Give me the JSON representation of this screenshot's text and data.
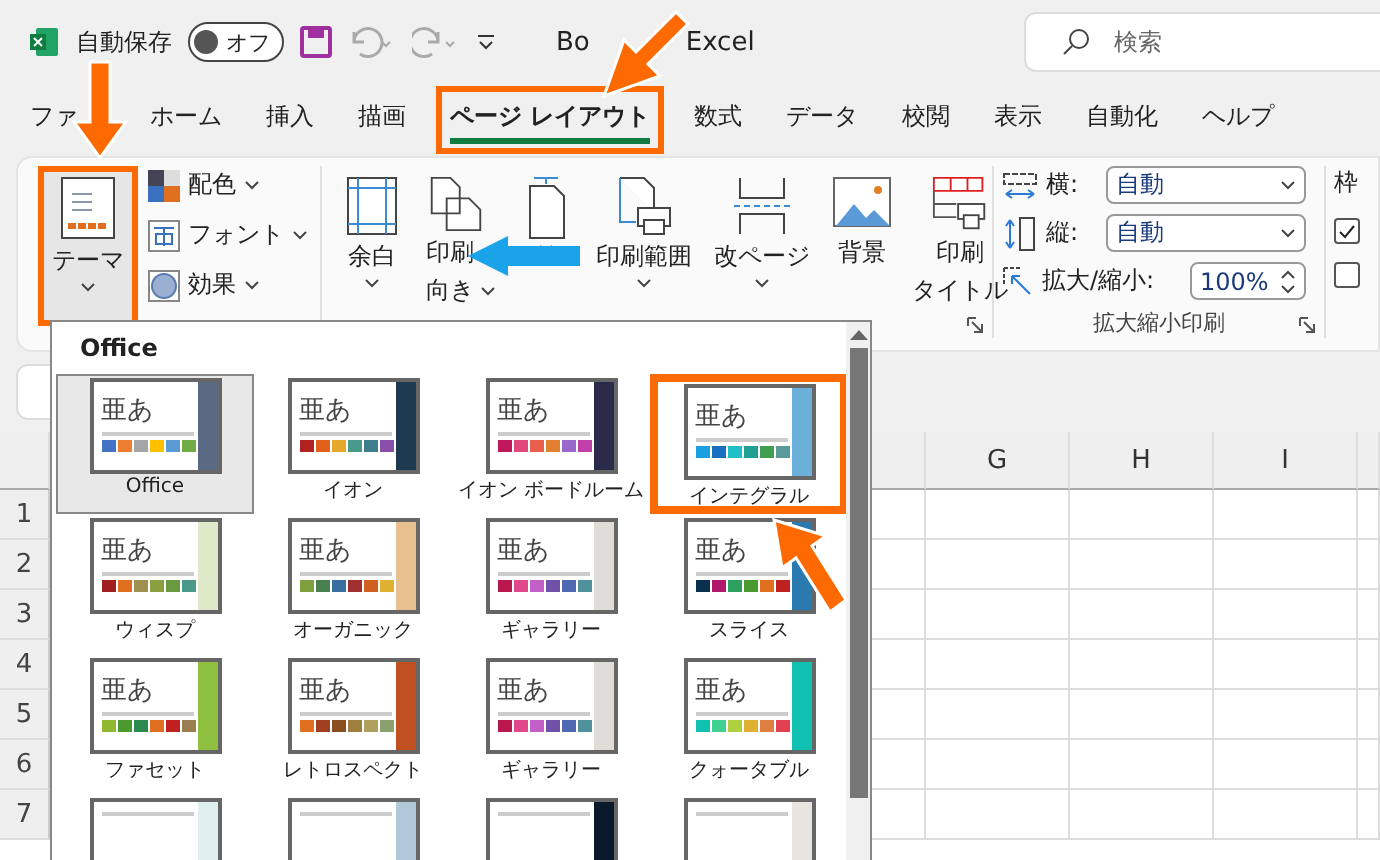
{
  "title_bar": {
    "autosave_label": "自動保存",
    "autosave_toggle": {
      "label": "オフ",
      "on": false
    },
    "doc_title": "Bo",
    "app_name": "Excel",
    "search": {
      "placeholder": "検索"
    }
  },
  "tabs": [
    {
      "label": "ファ",
      "selected": false
    },
    {
      "label": "ホーム",
      "selected": false
    },
    {
      "label": "挿入",
      "selected": false
    },
    {
      "label": "描画",
      "selected": false
    },
    {
      "label": "ページ レイアウト",
      "selected": true,
      "highlighted": true
    },
    {
      "label": "数式",
      "selected": false
    },
    {
      "label": "データ",
      "selected": false
    },
    {
      "label": "校閲",
      "selected": false
    },
    {
      "label": "表示",
      "selected": false
    },
    {
      "label": "自動化",
      "selected": false
    },
    {
      "label": "ヘルプ",
      "selected": false
    }
  ],
  "ribbon": {
    "theme_button": {
      "label": "テーマ",
      "highlighted": true
    },
    "theme_options": [
      {
        "kind": "colors",
        "label": "配色"
      },
      {
        "kind": "fonts",
        "label": "フォント"
      },
      {
        "kind": "effects",
        "label": "効果"
      }
    ],
    "page_setup": [
      {
        "kind": "margins",
        "lines": [
          "余白"
        ]
      },
      {
        "kind": "orientation",
        "lines": [
          "印刷",
          "向き"
        ]
      },
      {
        "kind": "size"
      },
      {
        "kind": "print_area",
        "lines": [
          "印刷範囲"
        ]
      },
      {
        "kind": "breaks",
        "lines": [
          "改ページ"
        ]
      },
      {
        "kind": "background",
        "lines": [
          "背景"
        ]
      },
      {
        "kind": "print_titles",
        "lines": [
          "印刷",
          "タイトル"
        ]
      }
    ],
    "scale": {
      "fields": [
        {
          "kind": "width",
          "label": "横:",
          "value": "自動"
        },
        {
          "kind": "height",
          "label": "縦:",
          "value": "自動"
        },
        {
          "kind": "scale",
          "label": "拡大/縮小:",
          "value": "100%"
        }
      ],
      "group_label": "拡大縮小印刷"
    },
    "sheet_options": {
      "title": "枠",
      "checks": [
        {
          "checked": true
        },
        {
          "checked": false
        }
      ]
    }
  },
  "sheet": {
    "columns": [
      "G",
      "H",
      "I"
    ],
    "rows": [
      "1",
      "2",
      "3",
      "4",
      "5",
      "6",
      "7"
    ]
  },
  "gallery": {
    "heading": "Office",
    "themes": [
      {
        "name": "Office",
        "sample_text": "亜あ",
        "selected": true,
        "highlighted": false,
        "color": "#5a6a85",
        "swatches": [
          {
            "color": "#4472c4"
          },
          {
            "color": "#ed7d31"
          },
          {
            "color": "#a5a5a5"
          },
          {
            "color": "#ffc000"
          },
          {
            "color": "#5b9bd5"
          },
          {
            "color": "#70ad47"
          }
        ]
      },
      {
        "name": "イオン",
        "sample_text": "亜あ",
        "selected": false,
        "highlighted": false,
        "color": "#1e3a50",
        "swatches": [
          {
            "color": "#b22222"
          },
          {
            "color": "#e0601c"
          },
          {
            "color": "#e6a82a"
          },
          {
            "color": "#4a9a8c"
          },
          {
            "color": "#3e7e8c"
          },
          {
            "color": "#8a4fa8"
          }
        ]
      },
      {
        "name": "イオン ボードルーム",
        "sample_text": "亜あ",
        "selected": false,
        "highlighted": false,
        "color": "#2a2a4a",
        "swatches": [
          {
            "color": "#c0185c"
          },
          {
            "color": "#e0487c"
          },
          {
            "color": "#e8604c"
          },
          {
            "color": "#e08030"
          },
          {
            "color": "#9a68c8"
          },
          {
            "color": "#c040a8"
          }
        ]
      },
      {
        "name": "インテグラル",
        "sample_text": "亜あ",
        "selected": false,
        "highlighted": true,
        "color": "#6ab0d8",
        "swatches": [
          {
            "color": "#1aa0e0"
          },
          {
            "color": "#1a70c0"
          },
          {
            "color": "#20c0c8"
          },
          {
            "color": "#20a090"
          },
          {
            "color": "#40a050"
          },
          {
            "color": "#5a9a9a"
          }
        ]
      },
      {
        "name": "ウィスプ",
        "sample_text": "亜あ",
        "selected": false,
        "highlighted": false,
        "color": "#dfe8c8",
        "swatches": [
          {
            "color": "#a02020"
          },
          {
            "color": "#e07020"
          },
          {
            "color": "#a09050"
          },
          {
            "color": "#8aa040"
          },
          {
            "color": "#6a9a40"
          },
          {
            "color": "#4a9a8a"
          }
        ]
      },
      {
        "name": "オーガニック",
        "sample_text": "亜あ",
        "selected": false,
        "highlighted": false,
        "color": "#e8c090",
        "swatches": [
          {
            "color": "#80a040"
          },
          {
            "color": "#4a8050"
          },
          {
            "color": "#3a70a0"
          },
          {
            "color": "#a03030"
          },
          {
            "color": "#d06020"
          },
          {
            "color": "#e0b030"
          }
        ]
      },
      {
        "name": "ギャラリー",
        "sample_text": "亜あ",
        "selected": false,
        "highlighted": false,
        "color": "#e0dcd8",
        "swatches": [
          {
            "color": "#b8184c"
          },
          {
            "color": "#e0488c"
          },
          {
            "color": "#c060c8"
          },
          {
            "color": "#7050a8"
          },
          {
            "color": "#5068b0"
          },
          {
            "color": "#50909a"
          }
        ]
      },
      {
        "name": "スライス",
        "sample_text": "亜あ",
        "selected": false,
        "highlighted": false,
        "color": "#2a7ab0",
        "swatches": [
          {
            "color": "#0a3050"
          },
          {
            "color": "#b0186c"
          },
          {
            "color": "#30a060"
          },
          {
            "color": "#4a9a30"
          },
          {
            "color": "#e07020"
          },
          {
            "color": "#c02020"
          }
        ]
      },
      {
        "name": "ファセット",
        "sample_text": "亜あ",
        "selected": false,
        "highlighted": false,
        "color": "#90c040",
        "swatches": [
          {
            "color": "#90b830"
          },
          {
            "color": "#4a9a30"
          },
          {
            "color": "#2a8a50"
          },
          {
            "color": "#e07020"
          },
          {
            "color": "#c02020"
          },
          {
            "color": "#9a8050"
          }
        ]
      },
      {
        "name": "レトロスペクト",
        "sample_text": "亜あ",
        "selected": false,
        "highlighted": false,
        "color": "#c05020",
        "swatches": [
          {
            "color": "#e07020"
          },
          {
            "color": "#a04020"
          },
          {
            "color": "#8a5020"
          },
          {
            "color": "#a08040"
          },
          {
            "color": "#b0a060"
          },
          {
            "color": "#8aa070"
          }
        ]
      },
      {
        "name": "ギャラリー",
        "sample_text": "亜あ",
        "selected": false,
        "highlighted": false,
        "color": "#e0dcd8",
        "swatches": [
          {
            "color": "#b8184c"
          },
          {
            "color": "#e0488c"
          },
          {
            "color": "#c060c8"
          },
          {
            "color": "#7050a8"
          },
          {
            "color": "#5068b0"
          },
          {
            "color": "#50909a"
          }
        ]
      },
      {
        "name": "クォータブル",
        "sample_text": "亜あ",
        "selected": false,
        "highlighted": false,
        "color": "#10c0b0",
        "swatches": [
          {
            "color": "#10c0b0"
          },
          {
            "color": "#40d090"
          },
          {
            "color": "#b0d040"
          },
          {
            "color": "#e0b030"
          },
          {
            "color": "#e08040"
          },
          {
            "color": "#e04050"
          }
        ]
      },
      {
        "selected": false,
        "highlighted": false,
        "color": "#e0eef0"
      },
      {
        "selected": false,
        "highlighted": false,
        "color": "#b0c8d8"
      },
      {
        "selected": false,
        "highlighted": false,
        "color": "#0a1a2a"
      },
      {
        "selected": false,
        "highlighted": false,
        "color": "#e8e4e0"
      }
    ]
  }
}
